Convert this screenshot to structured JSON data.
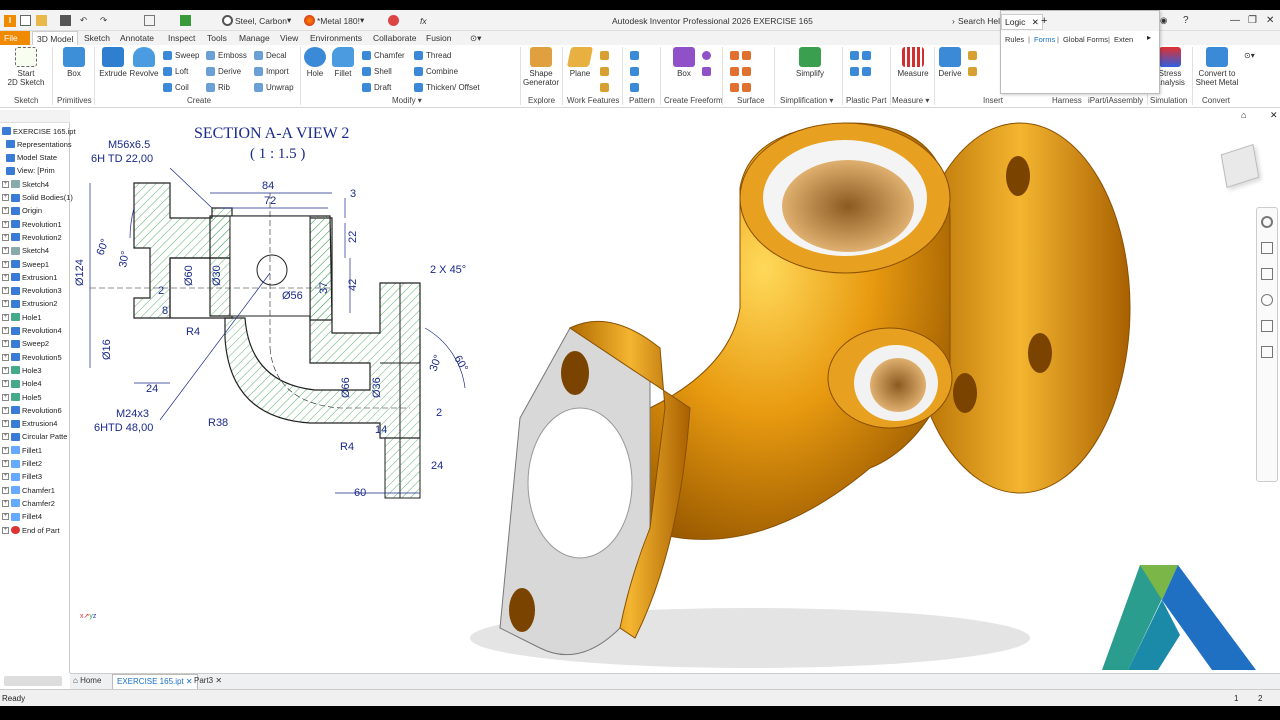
{
  "app": {
    "title": "Autodesk Inventor Professional 2026   EXERCISE 165",
    "search_placeholder": "Search Help"
  },
  "quick_access": {
    "material": "Steel, Carbon",
    "appearance": "*Metal 180!",
    "fx": "fx"
  },
  "ribbon_tabs": [
    "File",
    "3D Model",
    "Sketch",
    "Annotate",
    "Inspect",
    "Tools",
    "Manage",
    "View",
    "Environments",
    "Collaborate",
    "Fusion"
  ],
  "ribbon": {
    "sketch": {
      "start": "Start",
      "start2": "2D Sketch",
      "group": "Sketch"
    },
    "primitives": {
      "box": "Box",
      "group": "Primitives"
    },
    "create": {
      "extrude": "Extrude",
      "revolve": "Revolve",
      "sweep": "Sweep",
      "loft": "Loft",
      "coil": "Coil",
      "emboss": "Emboss",
      "derive": "Derive",
      "rib": "Rib",
      "decal": "Decal",
      "import": "Import",
      "unwrap": "Unwrap",
      "group": "Create"
    },
    "modify": {
      "hole": "Hole",
      "fillet": "Fillet",
      "chamfer": "Chamfer",
      "shell": "Shell",
      "draft": "Draft",
      "thread": "Thread",
      "combine": "Combine",
      "thicken": "Thicken/ Offset",
      "group": "Modify"
    },
    "explore": {
      "shape": "Shape",
      "shape2": "Generator",
      "group": "Explore"
    },
    "work": {
      "plane": "Plane",
      "group": "Work Features"
    },
    "pattern": {
      "group": "Pattern"
    },
    "freeform": {
      "box": "Box",
      "group": "Create Freeform"
    },
    "surface": {
      "group": "Surface"
    },
    "simplification": {
      "simplify": "Simplify",
      "group": "Simplification"
    },
    "plastic": {
      "group": "Plastic Part"
    },
    "measure": {
      "measure": "Measure",
      "group": "Measure"
    },
    "insert": {
      "derive": "Derive",
      "group": "Insert"
    },
    "harness": {
      "group": "Harness"
    },
    "ipart": {
      "group": "iPart/iAssembly"
    },
    "simulation": {
      "stress": "Stress",
      "stress2": "Analysis",
      "group": "Simulation"
    },
    "convert": {
      "label": "Convert to",
      "label2": "Sheet Metal",
      "group": "Convert"
    }
  },
  "logic_panel": {
    "title": "Logic",
    "tabs": [
      "Rules",
      "Forms",
      "Global Forms",
      "Exten"
    ]
  },
  "browser": {
    "items": [
      "EXERCISE 165.ipt",
      "Representations",
      "Model State",
      "View: [Prim",
      "Sketch4",
      "Solid Bodies(1)",
      "Origin",
      "Revolution1",
      "Revolution2",
      "Sketch4",
      "Sweep1",
      "Extrusion1",
      "Revolution3",
      "Extrusion2",
      "Hole1",
      "Revolution4",
      "Sweep2",
      "Revolution5",
      "Hole3",
      "Hole4",
      "Hole5",
      "Revolution6",
      "Extrusion4",
      "Circular Patte",
      "Fillet1",
      "Fillet2",
      "Fillet3",
      "Chamfer1",
      "Chamfer2",
      "Fillet4",
      "End of Part"
    ]
  },
  "drawing": {
    "title": "SECTION A-A VIEW 2",
    "scale": "( 1 : 1.5 )",
    "thread1a": "M56x6.5",
    "thread1b": "6H TD 22,00",
    "thread2a": "M24x3",
    "thread2b": "6HTD 48,00",
    "dims": {
      "d84": "84",
      "d72": "72",
      "d3": "3",
      "d22": "22",
      "d42": "42",
      "d37": "37",
      "d124": "Ø124",
      "d60a": "60°",
      "d30a": "30°",
      "d2a": "2",
      "d8": "8",
      "dd60": "Ø60",
      "dd30": "Ø30",
      "dd56": "Ø56",
      "r4a": "R4",
      "d16": "Ø16",
      "d24a": "24",
      "r38": "R38",
      "dd66": "Ø66",
      "dd36": "Ø36",
      "r4b": "R4",
      "d14": "14",
      "d2b": "2",
      "d24b": "24",
      "d60": "60",
      "chamfer": "2 X 45°",
      "d30b": "30°",
      "d60b": "60°"
    }
  },
  "document_tabs": [
    "Home",
    "EXERCISE 165.ipt",
    "Part3"
  ],
  "status": {
    "text": "Ready",
    "n1": "1",
    "n2": "2"
  },
  "colors": {
    "accent": "#f08a00",
    "part": "#e89a10",
    "drawing_ink": "#1a2a8a",
    "hatch": "#3aa04a"
  }
}
